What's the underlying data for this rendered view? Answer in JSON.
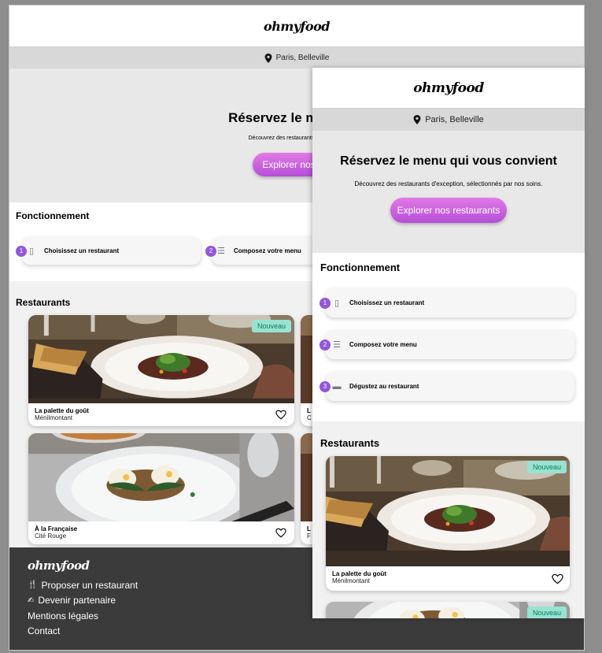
{
  "brand": {
    "logo_text": "ohmyfood"
  },
  "location": {
    "icon": "map-pin-icon",
    "text": "Paris, Belleville"
  },
  "hero": {
    "title": "Réservez le menu qui vous convient",
    "desktop_title_visible": "Réservez le menu qui",
    "subtitle": "Découvrez des restaurants d'exception, sélectionnés par nos soins.",
    "desktop_subtitle_visible": "Découvrez des restaurants d'exception,",
    "cta_label": "Explorer nos restaurants",
    "desktop_cta_visible": "Explorer nos res"
  },
  "how_it_works": {
    "title": "Fonctionnement",
    "steps": [
      {
        "number": "1",
        "icon": "smartphone-icon",
        "label": "Choisissez un restaurant"
      },
      {
        "number": "2",
        "icon": "list-icon",
        "label": "Composez votre menu"
      },
      {
        "number": "3",
        "icon": "store-icon",
        "label": "Dégustez au restaurant"
      }
    ]
  },
  "restaurants": {
    "title": "Restaurants",
    "badge_label": "Nouveau",
    "items": [
      {
        "name": "La palette du goût",
        "area": "Ménilmontant",
        "is_new": true
      },
      {
        "name": "À la Française",
        "area": "Cité Rouge",
        "is_new": false
      }
    ],
    "desktop_partial_cards": [
      {
        "name_fragment": "L",
        "area_fragment": "C"
      },
      {
        "name_fragment": "L",
        "area_fragment": "F"
      }
    ]
  },
  "footer": {
    "logo_text": "ohmyfood",
    "links": [
      {
        "icon": "cutlery-icon",
        "label": "Proposer un restaurant"
      },
      {
        "icon": "handshake-icon",
        "label": "Devenir partenaire"
      },
      {
        "icon": "",
        "label": "Mentions légales"
      },
      {
        "icon": "",
        "label": "Contact"
      }
    ]
  },
  "colors": {
    "accent_purple": "#9356dc",
    "cta_gradient_top": "#e27ae6",
    "cta_gradient_bottom": "#b44fd7",
    "badge_bg": "#99e2d0",
    "badge_text": "#087f61",
    "footer_bg": "#3b3b3b",
    "hero_bg": "#e8e8e8",
    "restaurants_bg": "#f1f1f1"
  }
}
